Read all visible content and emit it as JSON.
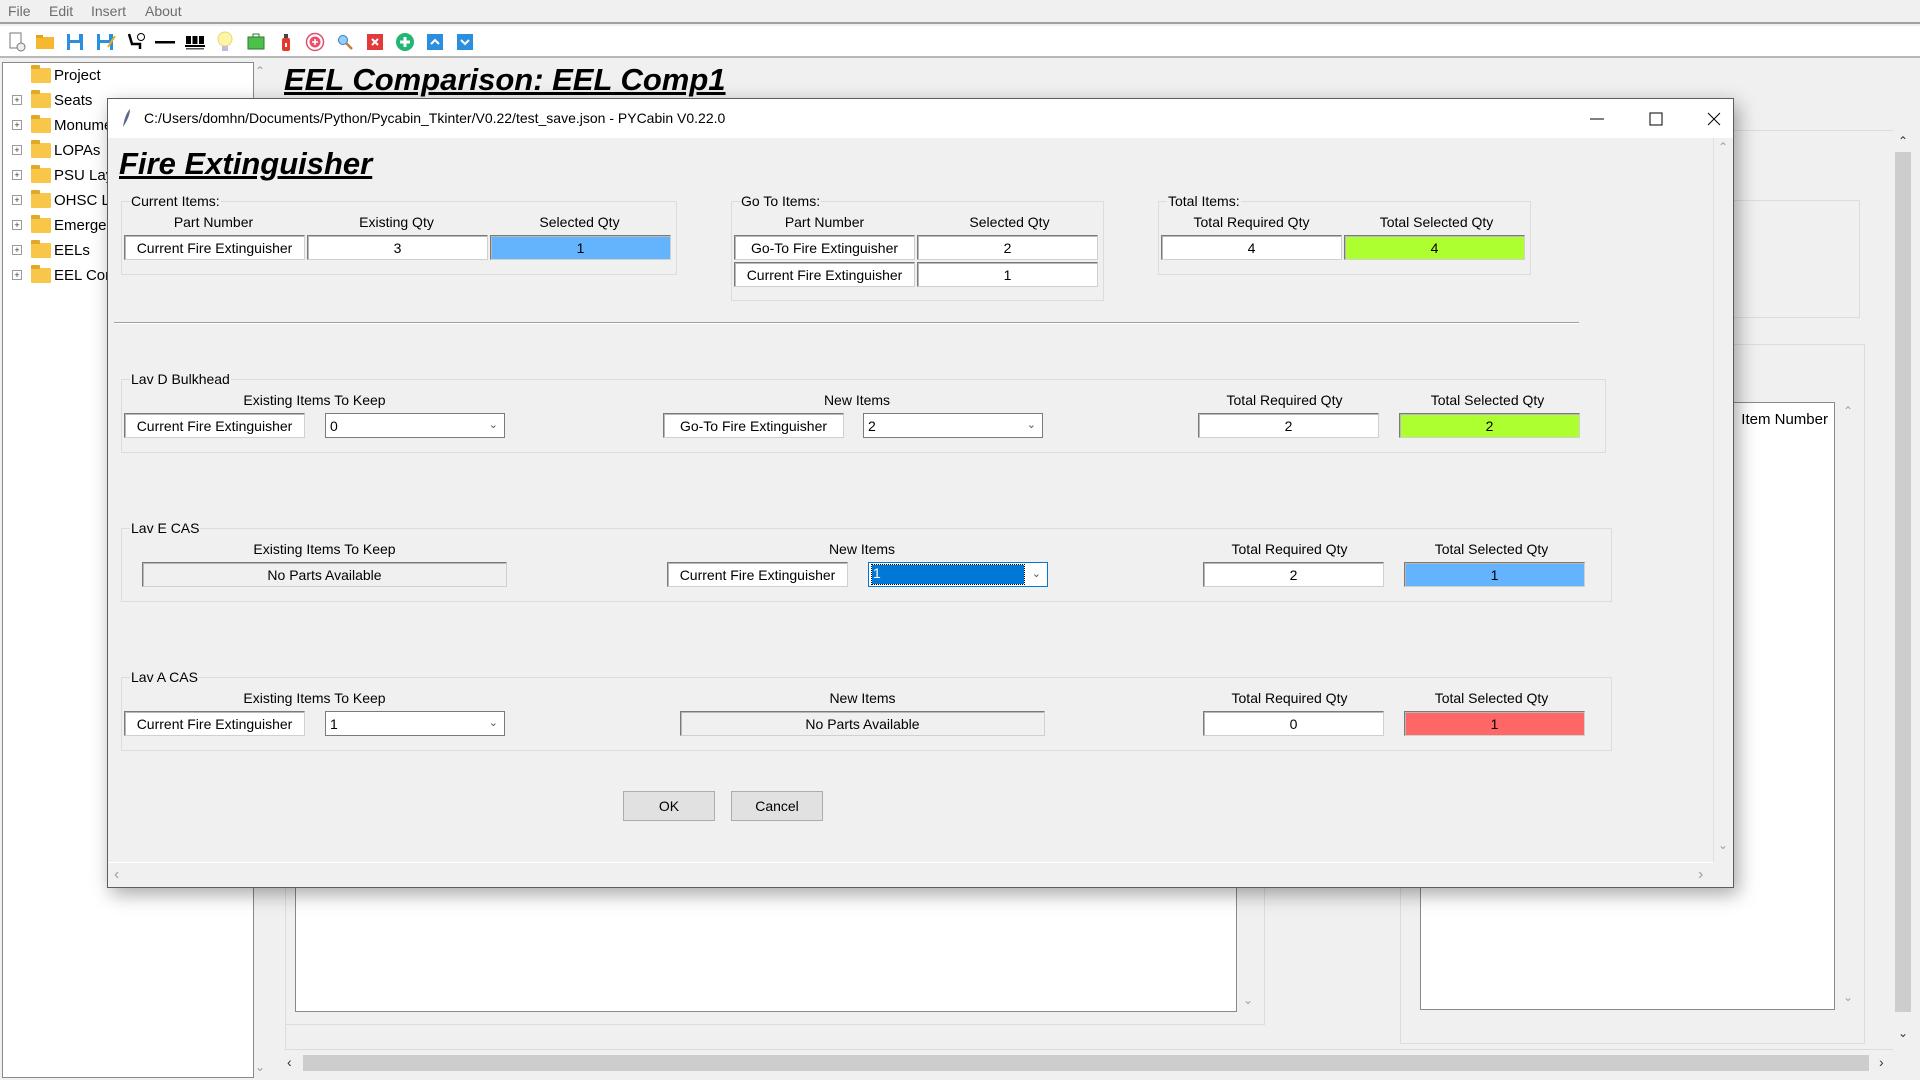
{
  "menu": [
    "File",
    "Edit",
    "Insert",
    "About"
  ],
  "toolbar_icons": [
    "new-file-icon",
    "open-folder-icon",
    "save-icon",
    "save-as-icon",
    "seat-icon",
    "line-icon",
    "seats-row-icon",
    "lightbulb-icon",
    "battery-icon",
    "fire-extinguisher-icon",
    "target-icon",
    "zoom-icon",
    "delete-icon",
    "add-icon",
    "move-up-icon",
    "move-down-icon"
  ],
  "tree": {
    "items": [
      {
        "label": "Project",
        "expandable": false
      },
      {
        "label": "Seats",
        "expandable": true
      },
      {
        "label": "Monuments",
        "expandable": true
      },
      {
        "label": "LOPAs",
        "expandable": true
      },
      {
        "label": "PSU Layouts",
        "expandable": true
      },
      {
        "label": "OHSC Layouts",
        "expandable": true
      },
      {
        "label": "Emergency Equipment",
        "expandable": true
      },
      {
        "label": "EELs",
        "expandable": true
      },
      {
        "label": "EEL Comparisons",
        "expandable": true
      }
    ]
  },
  "main": {
    "title": "EEL Comparison: EEL Comp1",
    "right_list_header": "Item Number"
  },
  "dialog": {
    "window_title": "C:/Users/domhn/Documents/Python/Pycabin_Tkinter/V0.22/test_save.json - PYCabin V0.22.0",
    "heading": "Fire Extinguisher",
    "current_items": {
      "label": "Current Items:",
      "headers": [
        "Part Number",
        "Existing Qty",
        "Selected Qty"
      ],
      "rows": [
        {
          "part": "Current Fire Extinguisher",
          "existing": "3",
          "selected": "1"
        }
      ]
    },
    "goto_items": {
      "label": "Go To Items:",
      "headers": [
        "Part Number",
        "Selected Qty"
      ],
      "rows": [
        {
          "part": "Go-To Fire Extinguisher",
          "selected": "2"
        },
        {
          "part": "Current Fire Extinguisher",
          "selected": "1"
        }
      ]
    },
    "total_items": {
      "label": "Total Items:",
      "headers": [
        "Total Required Qty",
        "Total Selected Qty"
      ],
      "required": "4",
      "selected": "4",
      "selected_status": "match"
    },
    "locations": [
      {
        "name": "Lav D Bulkhead",
        "existing_header": "Existing Items To Keep",
        "existing_part": "Current Fire Extinguisher",
        "existing_qty": "0",
        "new_header": "New Items",
        "new_part": "Go-To Fire Extinguisher",
        "new_qty": "2",
        "required_header": "Total Required Qty",
        "selected_header": "Total Selected Qty",
        "required": "2",
        "selected": "2",
        "selected_status": "match"
      },
      {
        "name": "Lav E CAS",
        "existing_header": "Existing Items To Keep",
        "existing_none": "No Parts Available",
        "new_header": "New Items",
        "new_part": "Current Fire Extinguisher",
        "new_qty": "1",
        "required_header": "Total Required Qty",
        "selected_header": "Total Selected Qty",
        "required": "2",
        "selected": "1",
        "selected_status": "under"
      },
      {
        "name": "Lav A CAS",
        "existing_header": "Existing Items To Keep",
        "existing_part": "Current Fire Extinguisher",
        "existing_qty": "1",
        "new_header": "New Items",
        "new_none": "No Parts Available",
        "required_header": "Total Required Qty",
        "selected_header": "Total Selected Qty",
        "required": "0",
        "selected": "1",
        "selected_status": "over"
      }
    ],
    "ok_label": "OK",
    "cancel_label": "Cancel"
  },
  "colors": {
    "match": "#adff2f",
    "under": "#63b3fd",
    "over": "#ff6666",
    "combo_selection": "#0078d7"
  }
}
